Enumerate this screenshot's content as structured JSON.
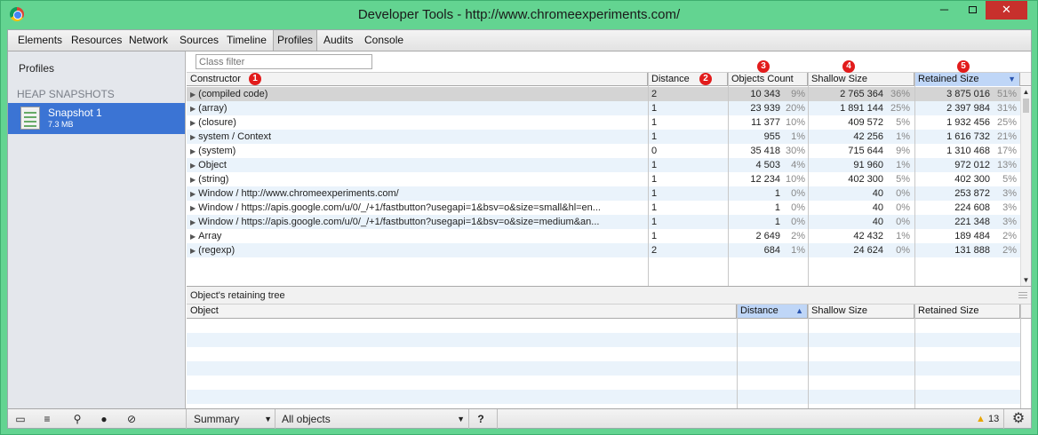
{
  "window": {
    "title": "Developer Tools - http://www.chromeexperiments.com/",
    "minimize_glyph": "─",
    "close_glyph": "✕"
  },
  "tabs": [
    "Elements",
    "Resources",
    "Network",
    "Sources",
    "Timeline",
    "Profiles",
    "Audits",
    "Console"
  ],
  "active_tab": "Profiles",
  "sidebar": {
    "profiles_label": "Profiles",
    "heap_heading": "HEAP SNAPSHOTS",
    "snapshot": {
      "name": "Snapshot 1",
      "size": "7.3 MB"
    }
  },
  "filter": {
    "placeholder": "Class filter"
  },
  "grid": {
    "headers": {
      "constructor": "Constructor",
      "distance": "Distance",
      "objects_count": "Objects Count",
      "shallow_size": "Shallow Size",
      "retained_size": "Retained Size"
    },
    "badges": [
      "1",
      "2",
      "3",
      "4",
      "5"
    ],
    "sort_glyph": "▼",
    "expand_glyph": "▶",
    "rows": [
      {
        "name": "(compiled code)",
        "distance": "2",
        "count": "10 343",
        "count_pct": "9%",
        "shallow": "2 765 364",
        "shallow_pct": "36%",
        "retained": "3 875 016",
        "retained_pct": "51%"
      },
      {
        "name": "(array)",
        "distance": "1",
        "count": "23 939",
        "count_pct": "20%",
        "shallow": "1 891 144",
        "shallow_pct": "25%",
        "retained": "2 397 984",
        "retained_pct": "31%"
      },
      {
        "name": "(closure)",
        "distance": "1",
        "count": "11 377",
        "count_pct": "10%",
        "shallow": "409 572",
        "shallow_pct": "5%",
        "retained": "1 932 456",
        "retained_pct": "25%"
      },
      {
        "name": "system / Context",
        "distance": "1",
        "count": "955",
        "count_pct": "1%",
        "shallow": "42 256",
        "shallow_pct": "1%",
        "retained": "1 616 732",
        "retained_pct": "21%"
      },
      {
        "name": "(system)",
        "distance": "0",
        "count": "35 418",
        "count_pct": "30%",
        "shallow": "715 644",
        "shallow_pct": "9%",
        "retained": "1 310 468",
        "retained_pct": "17%"
      },
      {
        "name": "Object",
        "distance": "1",
        "count": "4 503",
        "count_pct": "4%",
        "shallow": "91 960",
        "shallow_pct": "1%",
        "retained": "972 012",
        "retained_pct": "13%"
      },
      {
        "name": "(string)",
        "distance": "1",
        "count": "12 234",
        "count_pct": "10%",
        "shallow": "402 300",
        "shallow_pct": "5%",
        "retained": "402 300",
        "retained_pct": "5%"
      },
      {
        "name": "Window / http://www.chromeexperiments.com/",
        "distance": "1",
        "count": "1",
        "count_pct": "0%",
        "shallow": "40",
        "shallow_pct": "0%",
        "retained": "253 872",
        "retained_pct": "3%"
      },
      {
        "name": "Window / https://apis.google.com/u/0/_/+1/fastbutton?usegapi=1&bsv=o&size=small&hl=en...",
        "distance": "1",
        "count": "1",
        "count_pct": "0%",
        "shallow": "40",
        "shallow_pct": "0%",
        "retained": "224 608",
        "retained_pct": "3%"
      },
      {
        "name": "Window / https://apis.google.com/u/0/_/+1/fastbutton?usegapi=1&bsv=o&size=medium&an...",
        "distance": "1",
        "count": "1",
        "count_pct": "0%",
        "shallow": "40",
        "shallow_pct": "0%",
        "retained": "221 348",
        "retained_pct": "3%"
      },
      {
        "name": "Array",
        "distance": "1",
        "count": "2 649",
        "count_pct": "2%",
        "shallow": "42 432",
        "shallow_pct": "1%",
        "retained": "189 484",
        "retained_pct": "2%"
      },
      {
        "name": "(regexp)",
        "distance": "2",
        "count": "684",
        "count_pct": "1%",
        "shallow": "24 624",
        "shallow_pct": "0%",
        "retained": "131 888",
        "retained_pct": "2%"
      }
    ]
  },
  "retaining_tree": {
    "title": "Object's retaining tree",
    "headers": {
      "object": "Object",
      "distance": "Distance",
      "shallow_size": "Shallow Size",
      "retained_size": "Retained Size"
    },
    "sort_glyph": "▲"
  },
  "statusbar": {
    "view": "Summary",
    "filter": "All objects",
    "help": "?",
    "warning_count": "13"
  }
}
